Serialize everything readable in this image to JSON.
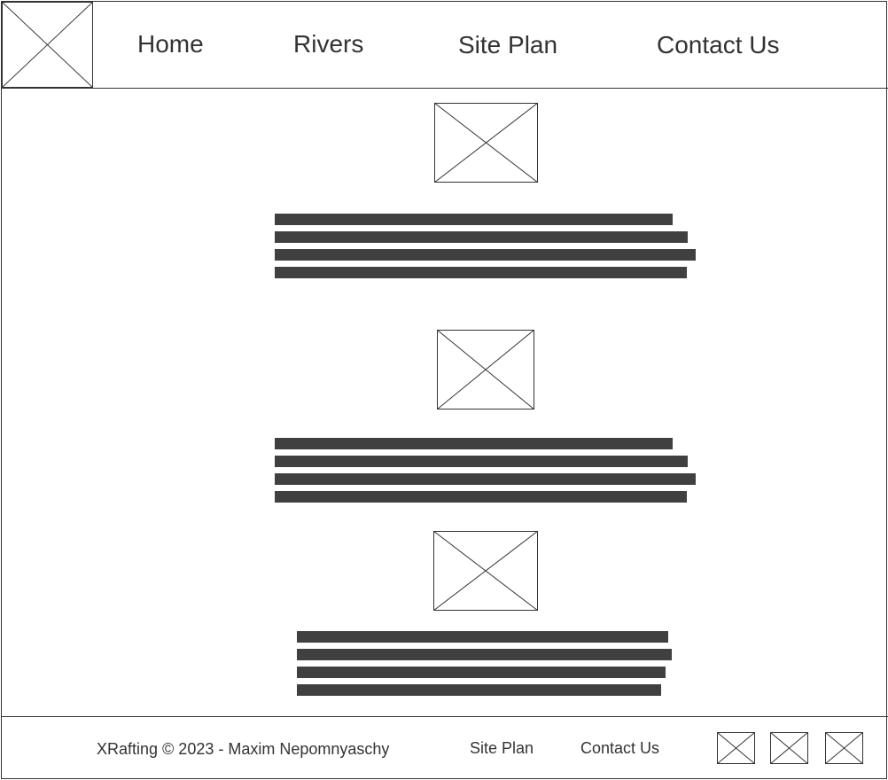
{
  "header": {
    "logo": "image-placeholder-icon",
    "nav": [
      {
        "label": "Home"
      },
      {
        "label": "Rivers"
      },
      {
        "label": "Site Plan"
      },
      {
        "label": "Contact Us"
      }
    ]
  },
  "main": {
    "sections": [
      {
        "image": "image-placeholder-icon",
        "text_lines": 4
      },
      {
        "image": "image-placeholder-icon",
        "text_lines": 4
      },
      {
        "image": "image-placeholder-icon",
        "text_lines": 4
      }
    ]
  },
  "footer": {
    "copyright": "XRafting © 2023 - Maxim Nepomnyaschy",
    "links": [
      {
        "label": "Site Plan"
      },
      {
        "label": "Contact Us"
      }
    ],
    "social_icons": [
      "image-placeholder-icon",
      "image-placeholder-icon",
      "image-placeholder-icon"
    ]
  },
  "colors": {
    "stroke": "#333333",
    "text_bar": "#404040",
    "background": "#ffffff"
  }
}
